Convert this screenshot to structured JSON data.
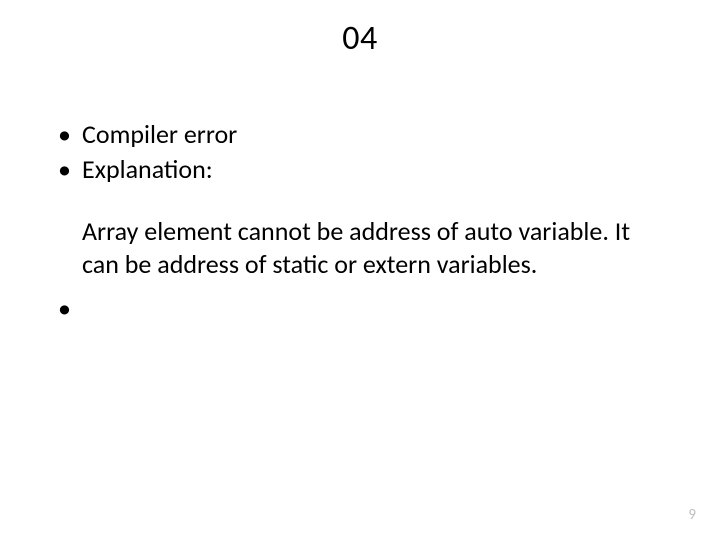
{
  "title": "04",
  "bullets": {
    "b1": "Compiler error",
    "b2": "Explanation:",
    "b3": ""
  },
  "paragraph": "Array element cannot be address of auto variable. It can be address of static or extern variables.",
  "page_number": "9"
}
